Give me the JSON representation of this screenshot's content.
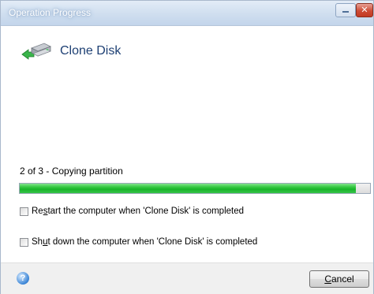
{
  "window": {
    "title": "Operation Progress"
  },
  "header": {
    "title": "Clone Disk",
    "icon": "clone-disk-icon"
  },
  "progress": {
    "status": "2 of 3 - Copying partition",
    "fraction": 0.96,
    "color": "#1fb92f"
  },
  "options": {
    "restart": {
      "prefix": "Re",
      "accesskey": "s",
      "suffix": "tart the computer when 'Clone Disk' is completed",
      "checked": false
    },
    "shutdown": {
      "prefix": "Sh",
      "accesskey": "u",
      "suffix": "t down the computer when 'Clone Disk' is completed",
      "checked": false
    }
  },
  "footer": {
    "cancel_accesskey": "C",
    "cancel_rest": "ancel"
  }
}
